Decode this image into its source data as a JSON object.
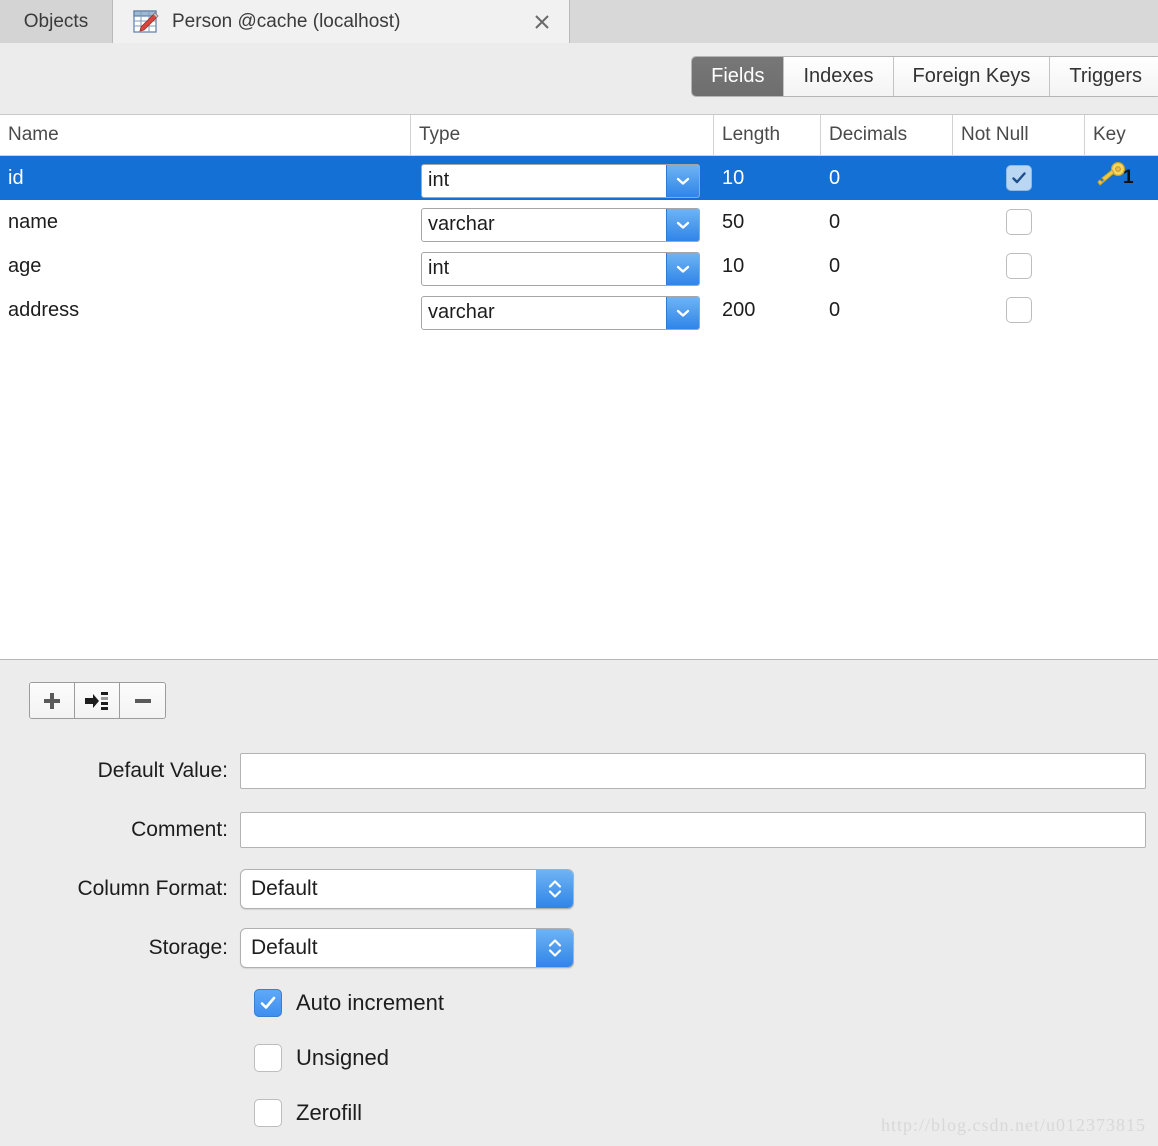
{
  "tabbar": {
    "objects_tab": "Objects",
    "active_tab": "Person @cache (localhost)",
    "close_label": "×"
  },
  "segmented": {
    "selected": "Fields",
    "items": [
      {
        "label": "Fields"
      },
      {
        "label": "Indexes"
      },
      {
        "label": "Foreign Keys"
      },
      {
        "label": "Triggers"
      }
    ]
  },
  "grid": {
    "columns": [
      {
        "label": "Name"
      },
      {
        "label": "Type"
      },
      {
        "label": "Length"
      },
      {
        "label": "Decimals"
      },
      {
        "label": "Not Null"
      },
      {
        "label": "Key"
      }
    ],
    "rows": [
      {
        "name": "id",
        "type": "int",
        "length": "10",
        "decimals": "0",
        "not_null": true,
        "key": "1",
        "selected": true
      },
      {
        "name": "name",
        "type": "varchar",
        "length": "50",
        "decimals": "0",
        "not_null": false,
        "key": "",
        "selected": false
      },
      {
        "name": "age",
        "type": "int",
        "length": "10",
        "decimals": "0",
        "not_null": false,
        "key": "",
        "selected": false
      },
      {
        "name": "address",
        "type": "varchar",
        "length": "200",
        "decimals": "0",
        "not_null": false,
        "key": "",
        "selected": false
      }
    ]
  },
  "toolbar": {
    "add_field_label": "+",
    "insert_field_label": "insert-field",
    "delete_field_label": "−"
  },
  "form": {
    "default_value": {
      "label": "Default Value:",
      "value": "",
      "placeholder": ""
    },
    "comment": {
      "label": "Comment:",
      "value": "",
      "placeholder": ""
    },
    "column_format": {
      "label": "Column Format:",
      "value": "Default"
    },
    "storage": {
      "label": "Storage:",
      "value": "Default"
    },
    "auto_increment": {
      "label": "Auto increment",
      "checked": true
    },
    "unsigned": {
      "label": "Unsigned",
      "checked": false
    },
    "zerofill": {
      "label": "Zerofill",
      "checked": false
    }
  },
  "watermark": "http://blog.csdn.net/u012373815",
  "colors": {
    "selection_blue": "#1470d4",
    "segment_selected": "#6e6e6e",
    "accent_blue": "#2f85e8",
    "panel_gray": "#ececec",
    "key_gold": "#f5cf4a"
  }
}
